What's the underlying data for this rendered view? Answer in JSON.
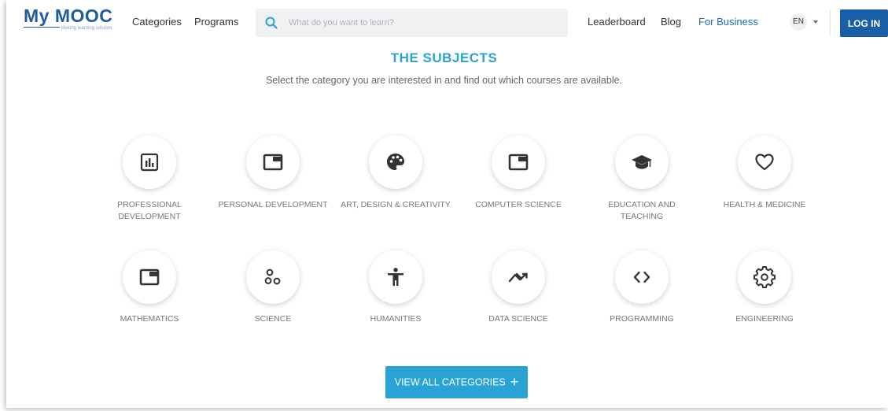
{
  "header": {
    "logo_text": "My MOOC",
    "logo_tagline": "lifelong learning solution",
    "nav": {
      "categories": "Categories",
      "programs": "Programs",
      "leaderboard": "Leaderboard",
      "blog": "Blog",
      "for_business": "For Business"
    },
    "search": {
      "placeholder": "What do you want to learn?",
      "value": ""
    },
    "language": "EN",
    "login_label": "LOG IN"
  },
  "section": {
    "title": "THE SUBJECTS",
    "subtitle": "Select the category you are interested in and find out which courses are available."
  },
  "subjects": [
    {
      "label": "PROFESSIONAL DEVELOPMENT",
      "icon": "chart-icon"
    },
    {
      "label": "PERSONAL DEVELOPMENT",
      "icon": "window-icon"
    },
    {
      "label": "ART, DESIGN & CREATIVITY",
      "icon": "palette-icon"
    },
    {
      "label": "COMPUTER SCIENCE",
      "icon": "window-icon"
    },
    {
      "label": "EDUCATION AND TEACHING",
      "icon": "graduation-cap-icon"
    },
    {
      "label": "HEALTH & MEDICINE",
      "icon": "heart-icon"
    },
    {
      "label": "MATHEMATICS",
      "icon": "window-icon"
    },
    {
      "label": "SCIENCE",
      "icon": "molecule-icon"
    },
    {
      "label": "HUMANITIES",
      "icon": "person-icon"
    },
    {
      "label": "DATA SCIENCE",
      "icon": "trend-icon"
    },
    {
      "label": "PROGRAMMING",
      "icon": "code-icon"
    },
    {
      "label": "ENGINEERING",
      "icon": "gear-icon"
    }
  ],
  "view_all_label": "VIEW ALL CATEGORIES",
  "view_all_icon": "plus-icon",
  "colors": {
    "brand": "#1f5c9c",
    "accent": "#29a3d6",
    "login": "#1a5ea8"
  }
}
